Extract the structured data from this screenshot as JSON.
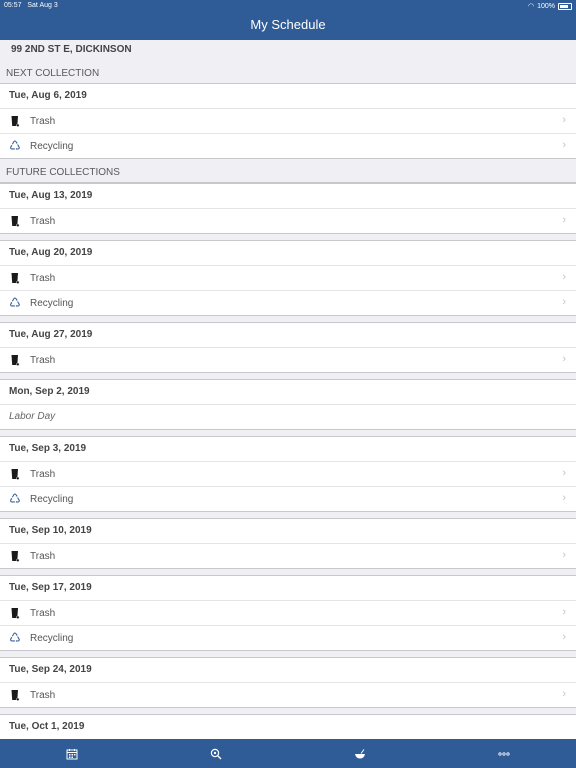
{
  "status": {
    "time": "05:57",
    "date": "Sat Aug 3",
    "battery": "100%"
  },
  "header": {
    "title": "My Schedule"
  },
  "address": "99 2ND ST E, DICKINSON",
  "sections": {
    "next": "NEXT COLLECTION",
    "future": "FUTURE COLLECTIONS"
  },
  "next": {
    "date": "Tue, Aug 6, 2019",
    "items": [
      "Trash",
      "Recycling"
    ]
  },
  "future": [
    {
      "date": "Tue, Aug 13, 2019",
      "items": [
        "Trash"
      ]
    },
    {
      "date": "Tue, Aug 20, 2019",
      "items": [
        "Trash",
        "Recycling"
      ]
    },
    {
      "date": "Tue, Aug 27, 2019",
      "items": [
        "Trash"
      ]
    },
    {
      "date": "Mon, Sep 2, 2019",
      "note": "Labor Day"
    },
    {
      "date": "Tue, Sep 3, 2019",
      "items": [
        "Trash",
        "Recycling"
      ]
    },
    {
      "date": "Tue, Sep 10, 2019",
      "items": [
        "Trash"
      ]
    },
    {
      "date": "Tue, Sep 17, 2019",
      "items": [
        "Trash",
        "Recycling"
      ]
    },
    {
      "date": "Tue, Sep 24, 2019",
      "items": [
        "Trash"
      ]
    },
    {
      "date": "Tue, Oct 1, 2019",
      "items": []
    }
  ],
  "tabs": [
    {
      "icon": "calendar-icon"
    },
    {
      "icon": "search-location-icon"
    },
    {
      "icon": "bowl-icon"
    },
    {
      "icon": "more-icon"
    }
  ]
}
